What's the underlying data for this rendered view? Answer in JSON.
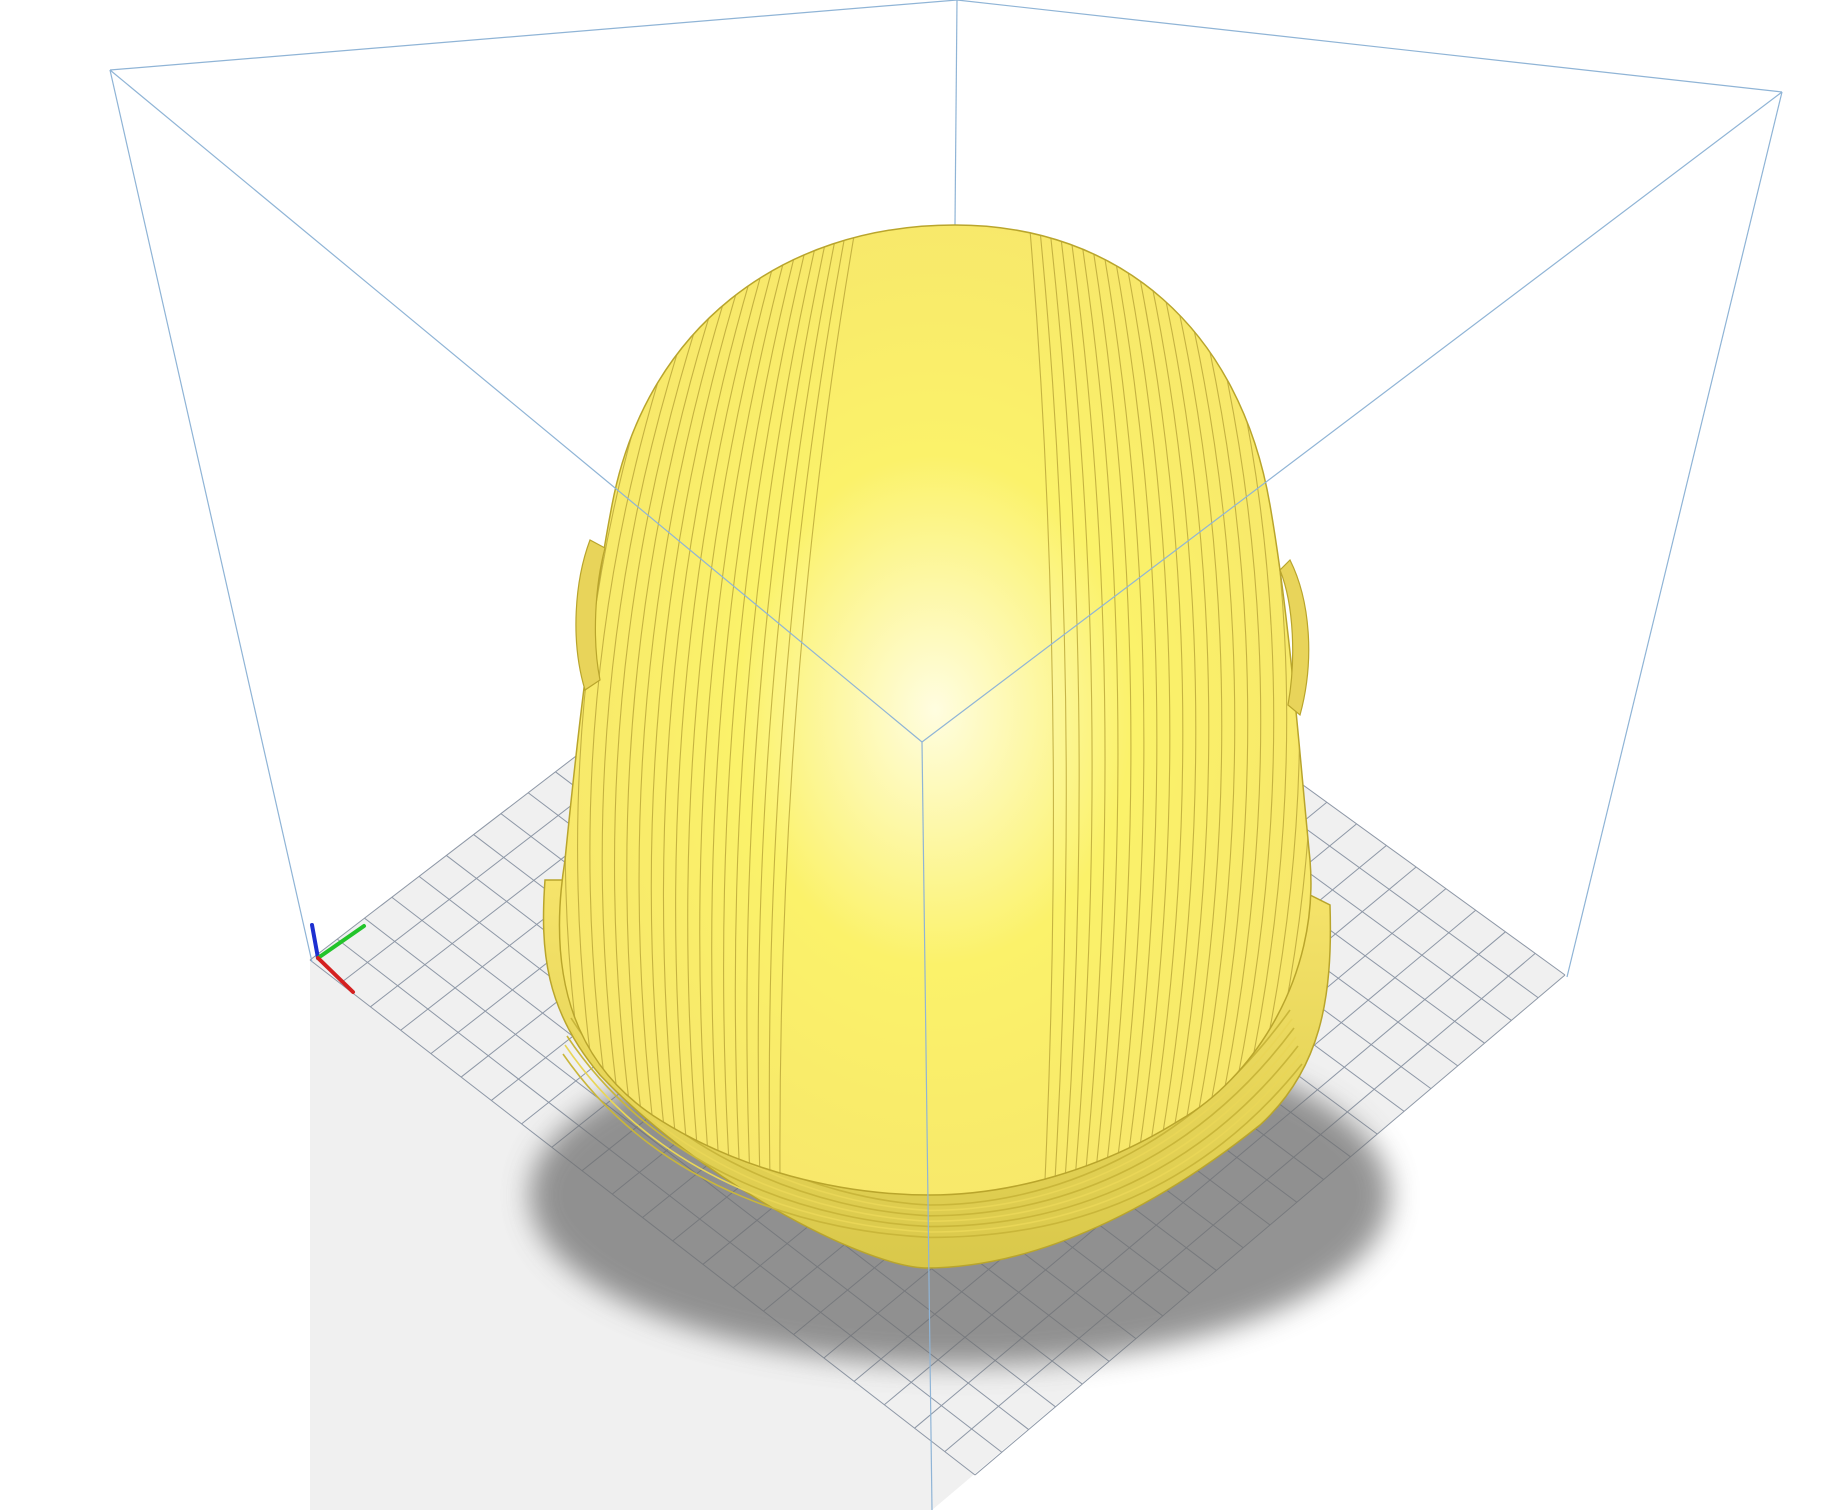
{
  "app": {
    "view": "3d-viewport"
  },
  "scene": {
    "background_color": "#ffffff",
    "volume_edge_color": "#8fb4d6",
    "plate": {
      "fill_color": "#f0f0f0",
      "grid_color": "#8d97a6",
      "grid_divisions": 22
    },
    "model": {
      "object": "helmet",
      "color": "#f6e46b",
      "highlight_color": "#fffde0",
      "shadow_color": "#b9a52c"
    },
    "axes": {
      "x_color": "#d42020",
      "y_color": "#22c42a",
      "z_color": "#1d2fd0"
    }
  }
}
